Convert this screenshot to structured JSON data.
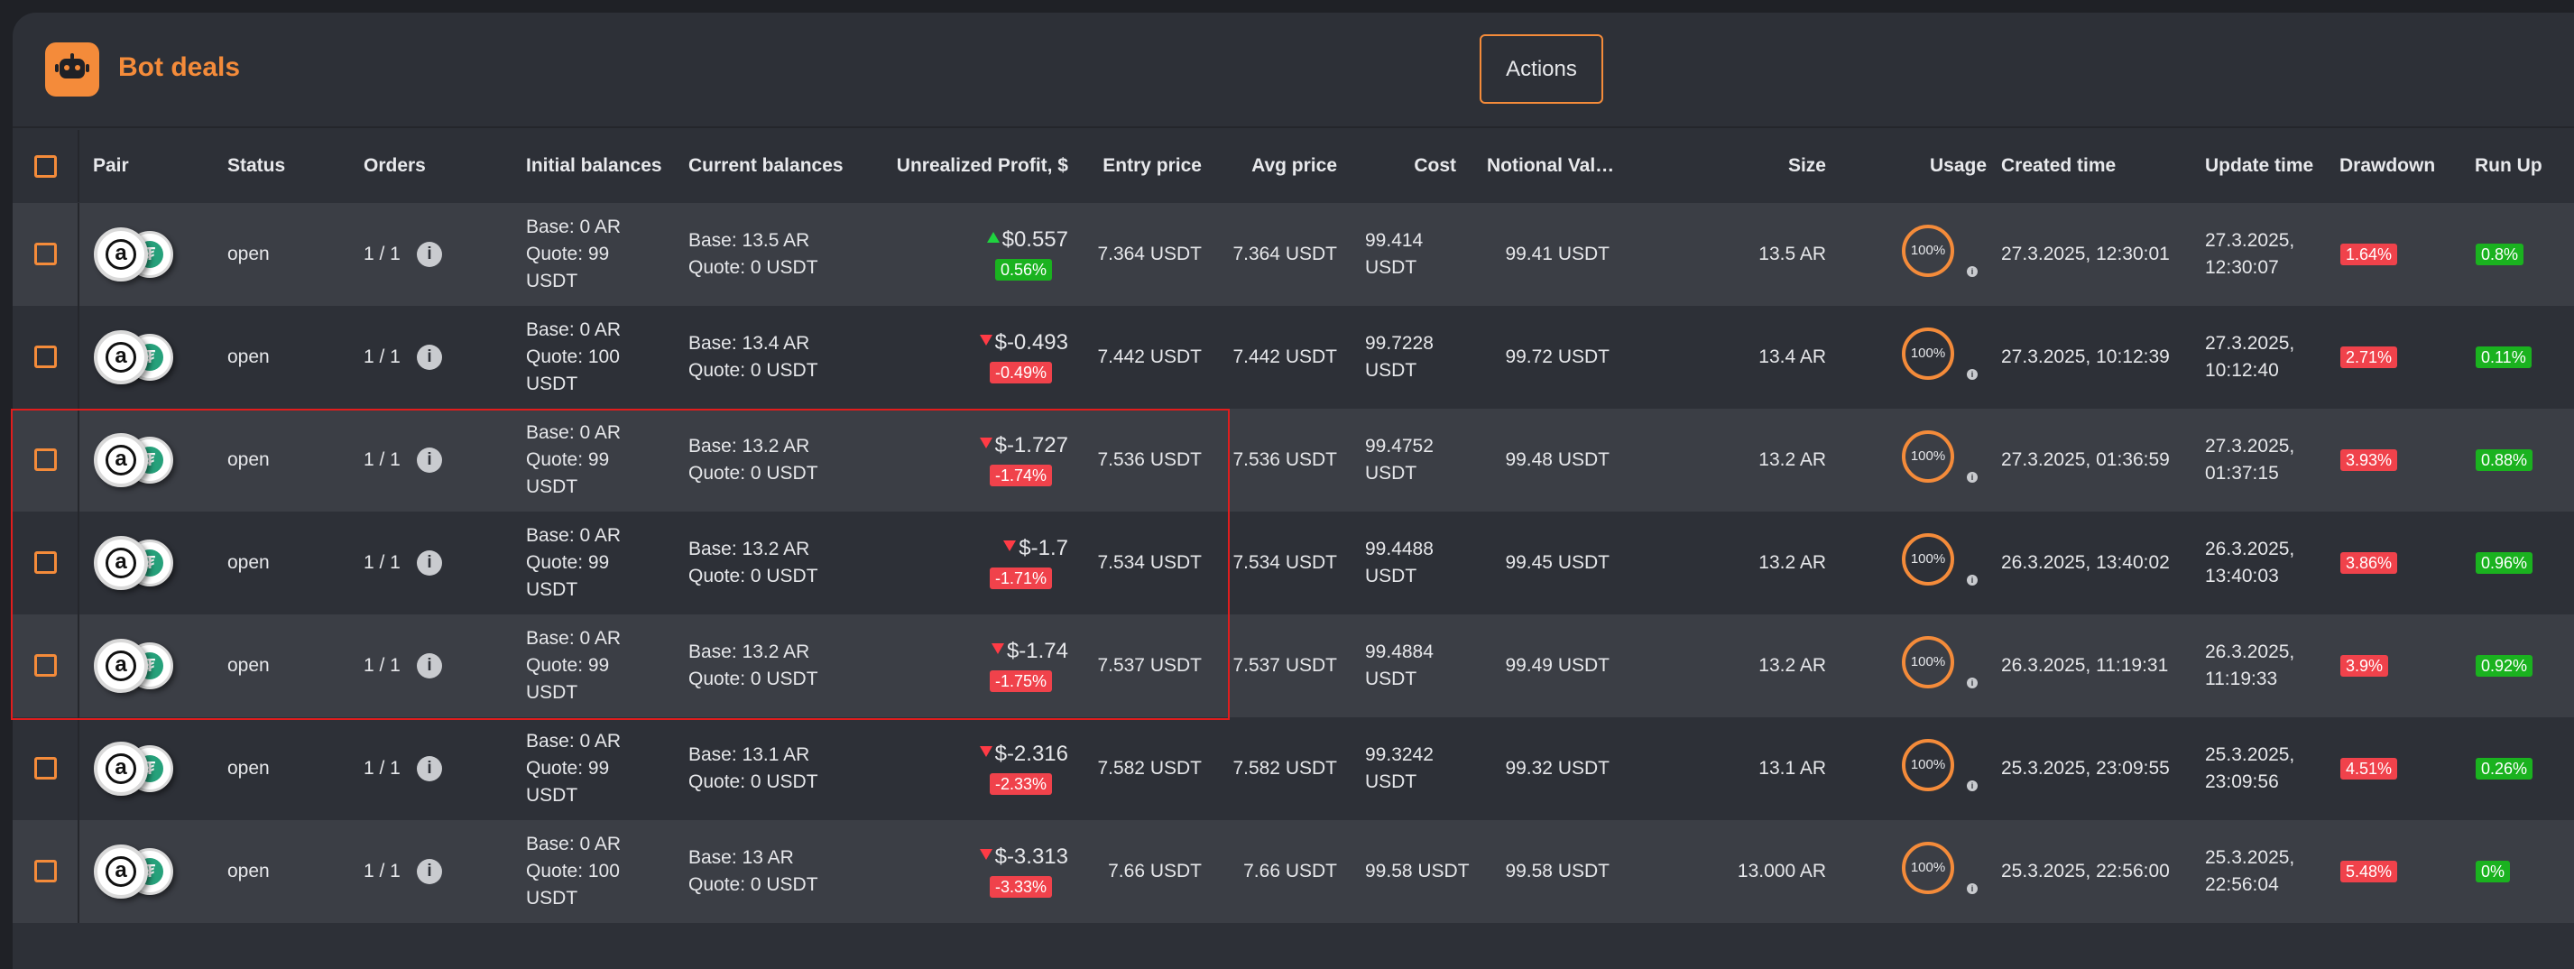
{
  "header": {
    "title": "Bot deals",
    "actions_label": "Actions",
    "bot_icon": "robot-icon"
  },
  "columns": {
    "pair": "Pair",
    "status": "Status",
    "orders": "Orders",
    "initial_balances": "Initial balances",
    "current_balances": "Current balances",
    "unrealized_profit": "Unrealized Profit, $",
    "entry_price": "Entry price",
    "avg_price": "Avg price",
    "cost": "Cost",
    "notional_value": "Notional Val…",
    "size": "Size",
    "usage": "Usage",
    "created_time": "Created time",
    "update_time": "Update time",
    "drawdown": "Drawdown",
    "run_up": "Run Up"
  },
  "colors": {
    "accent": "#f48b3a",
    "positive": "#1ab21f",
    "negative": "#f0424b",
    "highlight_border": "#e11d1d"
  },
  "coin_icons": {
    "base": "a",
    "quote": "₮"
  },
  "info_glyph": "i",
  "rows": [
    {
      "status": "open",
      "orders": "1 / 1",
      "init_base": "Base: 0 AR",
      "init_quote_1": "Quote: 99",
      "init_quote_2": "USDT",
      "cur_base": "Base: 13.5 AR",
      "cur_quote": "Quote: 0 USDT",
      "profit": "$0.557",
      "profit_dir": "up",
      "profit_pct": "0.56%",
      "entry": "7.364 USDT",
      "avg": "7.364 USDT",
      "cost_1": "99.414",
      "cost_2": "USDT",
      "notional": "99.41 USDT",
      "size": "13.5 AR",
      "usage": "100%",
      "created": "27.3.2025, 12:30:01",
      "update_1": "27.3.2025,",
      "update_2": "12:30:07",
      "drawdown": "1.64%",
      "runup": "0.8%"
    },
    {
      "status": "open",
      "orders": "1 / 1",
      "init_base": "Base: 0 AR",
      "init_quote_1": "Quote: 100",
      "init_quote_2": "USDT",
      "cur_base": "Base: 13.4 AR",
      "cur_quote": "Quote: 0 USDT",
      "profit": "$-0.493",
      "profit_dir": "down",
      "profit_pct": "-0.49%",
      "entry": "7.442 USDT",
      "avg": "7.442 USDT",
      "cost_1": "99.7228",
      "cost_2": "USDT",
      "notional": "99.72 USDT",
      "size": "13.4 AR",
      "usage": "100%",
      "created": "27.3.2025, 10:12:39",
      "update_1": "27.3.2025,",
      "update_2": "10:12:40",
      "drawdown": "2.71%",
      "runup": "0.11%"
    },
    {
      "status": "open",
      "orders": "1 / 1",
      "init_base": "Base: 0 AR",
      "init_quote_1": "Quote: 99",
      "init_quote_2": "USDT",
      "cur_base": "Base: 13.2 AR",
      "cur_quote": "Quote: 0 USDT",
      "profit": "$-1.727",
      "profit_dir": "down",
      "profit_pct": "-1.74%",
      "entry": "7.536 USDT",
      "avg": "7.536 USDT",
      "cost_1": "99.4752",
      "cost_2": "USDT",
      "notional": "99.48 USDT",
      "size": "13.2 AR",
      "usage": "100%",
      "created": "27.3.2025, 01:36:59",
      "update_1": "27.3.2025,",
      "update_2": "01:37:15",
      "drawdown": "3.93%",
      "runup": "0.88%"
    },
    {
      "status": "open",
      "orders": "1 / 1",
      "init_base": "Base: 0 AR",
      "init_quote_1": "Quote: 99",
      "init_quote_2": "USDT",
      "cur_base": "Base: 13.2 AR",
      "cur_quote": "Quote: 0 USDT",
      "profit": "$-1.7",
      "profit_dir": "down",
      "profit_pct": "-1.71%",
      "entry": "7.534 USDT",
      "avg": "7.534 USDT",
      "cost_1": "99.4488",
      "cost_2": "USDT",
      "notional": "99.45 USDT",
      "size": "13.2 AR",
      "usage": "100%",
      "created": "26.3.2025, 13:40:02",
      "update_1": "26.3.2025,",
      "update_2": "13:40:03",
      "drawdown": "3.86%",
      "runup": "0.96%"
    },
    {
      "status": "open",
      "orders": "1 / 1",
      "init_base": "Base: 0 AR",
      "init_quote_1": "Quote: 99",
      "init_quote_2": "USDT",
      "cur_base": "Base: 13.2 AR",
      "cur_quote": "Quote: 0 USDT",
      "profit": "$-1.74",
      "profit_dir": "down",
      "profit_pct": "-1.75%",
      "entry": "7.537 USDT",
      "avg": "7.537 USDT",
      "cost_1": "99.4884",
      "cost_2": "USDT",
      "notional": "99.49 USDT",
      "size": "13.2 AR",
      "usage": "100%",
      "created": "26.3.2025, 11:19:31",
      "update_1": "26.3.2025,",
      "update_2": "11:19:33",
      "drawdown": "3.9%",
      "runup": "0.92%"
    },
    {
      "status": "open",
      "orders": "1 / 1",
      "init_base": "Base: 0 AR",
      "init_quote_1": "Quote: 99",
      "init_quote_2": "USDT",
      "cur_base": "Base: 13.1 AR",
      "cur_quote": "Quote: 0 USDT",
      "profit": "$-2.316",
      "profit_dir": "down",
      "profit_pct": "-2.33%",
      "entry": "7.582 USDT",
      "avg": "7.582 USDT",
      "cost_1": "99.3242",
      "cost_2": "USDT",
      "notional": "99.32 USDT",
      "size": "13.1 AR",
      "usage": "100%",
      "created": "25.3.2025, 23:09:55",
      "update_1": "25.3.2025,",
      "update_2": "23:09:56",
      "drawdown": "4.51%",
      "runup": "0.26%"
    },
    {
      "status": "open",
      "orders": "1 / 1",
      "init_base": "Base: 0 AR",
      "init_quote_1": "Quote: 100",
      "init_quote_2": "USDT",
      "cur_base": "Base: 13 AR",
      "cur_quote": "Quote: 0 USDT",
      "profit": "$-3.313",
      "profit_dir": "down",
      "profit_pct": "-3.33%",
      "entry": "7.66 USDT",
      "avg": "7.66 USDT",
      "cost_1": "99.58 USDT",
      "cost_2": "",
      "notional": "99.58 USDT",
      "size": "13.000 AR",
      "usage": "100%",
      "created": "25.3.2025, 22:56:00",
      "update_1": "25.3.2025,",
      "update_2": "22:56:04",
      "drawdown": "5.48%",
      "runup": "0%"
    }
  ]
}
